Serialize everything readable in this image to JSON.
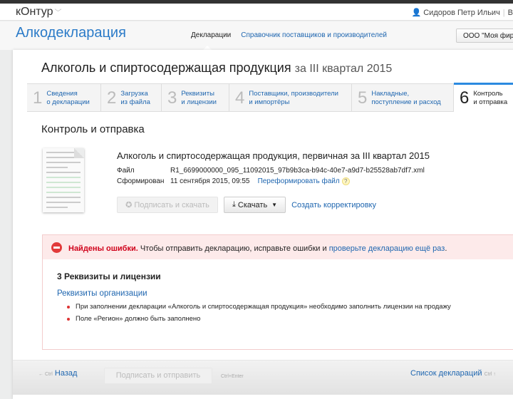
{
  "topbar": {
    "logo": "кОнтур",
    "user": "Сидоров Петр Ильич",
    "extra": "В"
  },
  "app": {
    "title": "Алкодекларация",
    "nav": [
      "Декларации",
      "Справочник поставщиков и производителей"
    ],
    "org": "ООО \"Моя фирма\""
  },
  "page": {
    "title": "Алкоголь и спиртосодержащая продукция",
    "period": "за III квартал 2015"
  },
  "steps": [
    {
      "num": "1",
      "l1": "Сведения",
      "l2": "о декларации"
    },
    {
      "num": "2",
      "l1": "Загрузка",
      "l2": "из файла"
    },
    {
      "num": "3",
      "l1": "Реквизиты",
      "l2": "и лицензии"
    },
    {
      "num": "4",
      "l1": "Поставщики, производители",
      "l2": "и импортёры"
    },
    {
      "num": "5",
      "l1": "Накладные,",
      "l2": "поступление и расход"
    },
    {
      "num": "6",
      "l1": "Контроль",
      "l2": "и отправка"
    }
  ],
  "section": "Контроль и отправка",
  "doc": {
    "title": "Алкоголь и спиртосодержащая продукция, первичная за III квартал 2015",
    "file_label": "Файл",
    "file": "R1_6699000000_095_11092015_97b9b3ca-b94c-40e7-a9d7-b25528ab7df7.xml",
    "formed_label": "Сформирован",
    "formed": "11 сентября 2015, 09:55",
    "reform": "Переформировать файл",
    "help": "?"
  },
  "actions": {
    "sign_download": "Подписать и скачать",
    "download": "Скачать",
    "correction": "Создать корректировку"
  },
  "error": {
    "title": "Найдены ошибки.",
    "text": " Чтобы отправить декларацию, исправьте ошибки и ",
    "link": "проверьте декларацию ещё раз",
    "end": ".",
    "section": "3 Реквизиты и лицензии",
    "subsection": "Реквизиты организации",
    "items": [
      "При заполнении декларации «Алкоголь и спиртосодержащая продукция» необходимо заполнить лицензии на продажу",
      "Поле «Регион» должно быть заполнено"
    ]
  },
  "footer": {
    "back_hint": "← Ctrl",
    "back": "Назад",
    "send": "Подписать и отправить",
    "send_hint": "Ctrl+Enter",
    "list": "Список деклараций",
    "list_hint": "Ctrl ↑"
  }
}
